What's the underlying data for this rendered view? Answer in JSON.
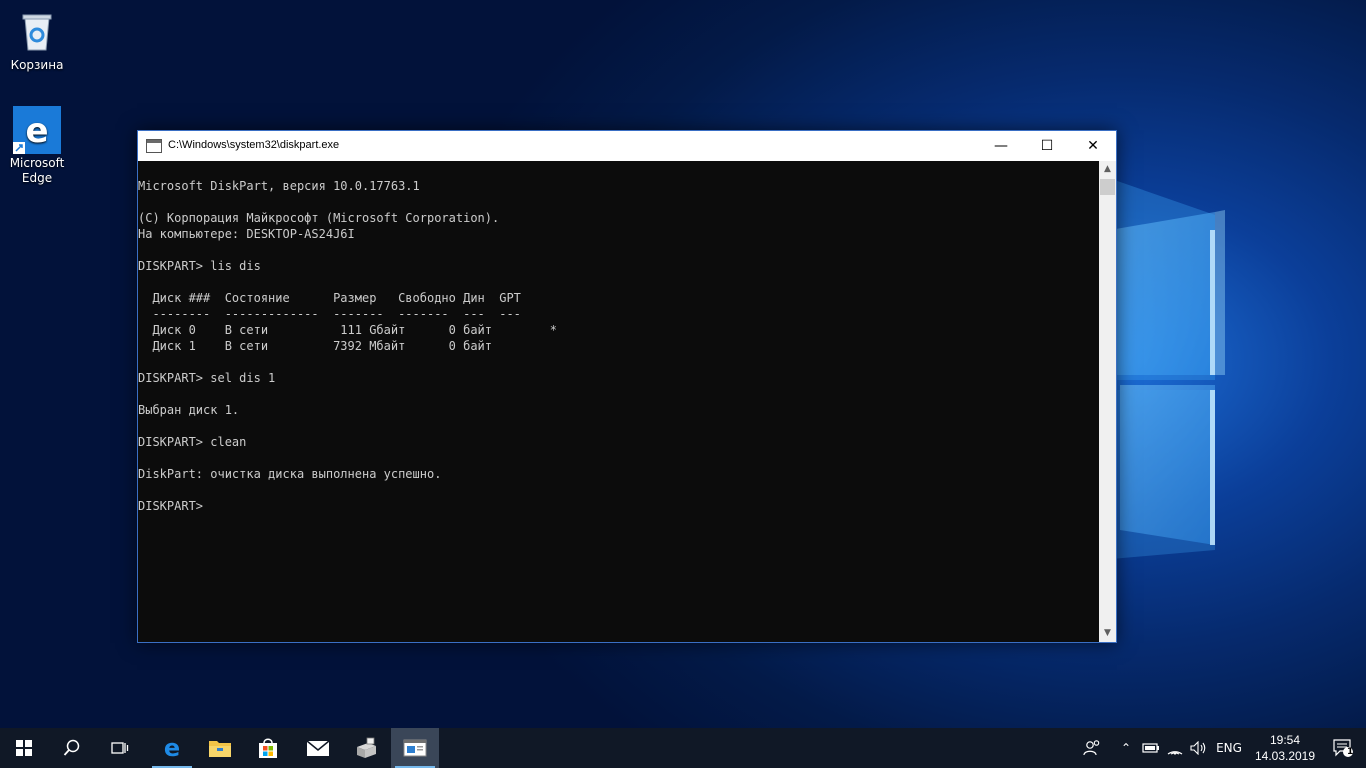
{
  "desktop": {
    "icons": [
      {
        "label": "Корзина"
      },
      {
        "label": "Microsoft Edge"
      }
    ]
  },
  "window": {
    "title": "C:\\Windows\\system32\\diskpart.exe",
    "minimize_icon": "minimize-icon",
    "maximize_icon": "maximize-icon",
    "close_icon": "close-icon"
  },
  "console": {
    "lines": [
      "Microsoft DiskPart, версия 10.0.17763.1",
      "",
      "(C) Корпорация Майкрософт (Microsoft Corporation).",
      "На компьютере: DESKTOP-AS24J6I",
      "",
      "DISKPART> lis dis",
      "",
      "  Диск ###  Состояние      Размер   Свободно Дин  GPT",
      "  --------  -------------  -------  -------  ---  ---",
      "  Диск 0    В сети          111 Gбайт      0 байт        *",
      "  Диск 1    В сети         7392 Mбайт      0 байт",
      "",
      "DISKPART> sel dis 1",
      "",
      "Выбран диск 1.",
      "",
      "DISKPART> clean",
      "",
      "DiskPart: очистка диска выполнена успешно.",
      "",
      "DISKPART>"
    ]
  },
  "taskbar": {
    "items": [
      {
        "name": "start-button",
        "icon": "windows-logo-icon"
      },
      {
        "name": "search-button",
        "icon": "search-icon"
      },
      {
        "name": "task-view-button",
        "icon": "task-view-icon"
      },
      {
        "name": "edge-taskbar",
        "icon": "edge-icon"
      },
      {
        "name": "explorer-taskbar",
        "icon": "folder-icon"
      },
      {
        "name": "store-taskbar",
        "icon": "store-icon"
      },
      {
        "name": "mail-taskbar",
        "icon": "mail-icon"
      },
      {
        "name": "setup-taskbar",
        "icon": "setup-icon"
      },
      {
        "name": "diskpart-taskbar",
        "icon": "console-icon"
      }
    ],
    "tray": {
      "language": "ENG",
      "time": "19:54",
      "date": "14.03.2019",
      "notification_count": "1"
    }
  }
}
